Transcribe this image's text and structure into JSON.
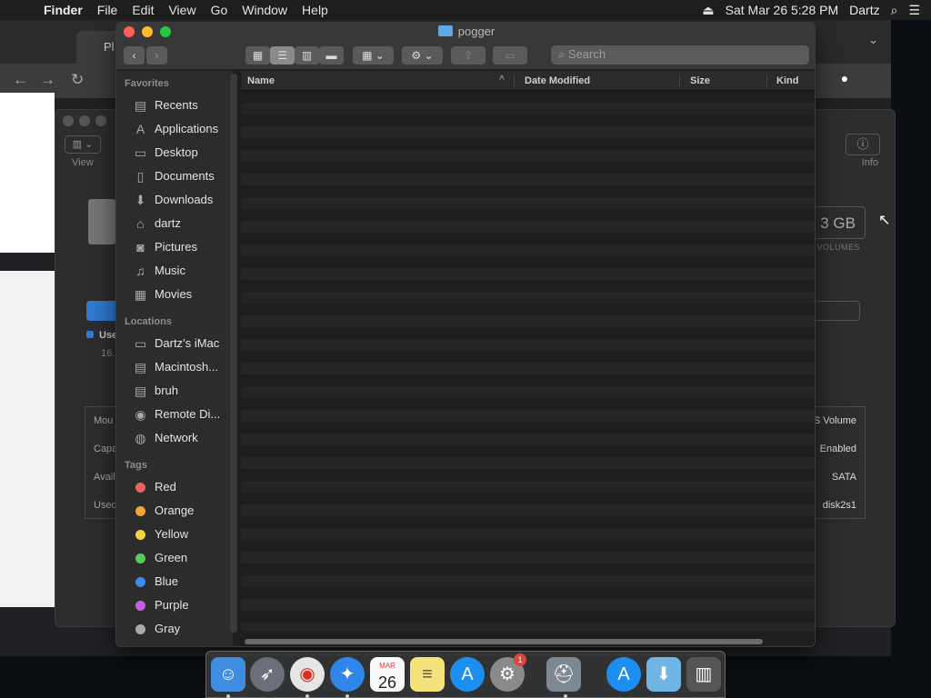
{
  "menubar": {
    "app": "Finder",
    "items": [
      "File",
      "Edit",
      "View",
      "Go",
      "Window",
      "Help"
    ],
    "clock": "Sat Mar 26  5:28 PM",
    "user": "Dartz"
  },
  "browser": {
    "tab_label": "Pl"
  },
  "disk_utility": {
    "view_label": "View",
    "info_label": "Info",
    "capacity": "3 GB",
    "volumes_label": "VOLUMES",
    "used_label": "Use",
    "used_value": "16.",
    "rows": [
      {
        "key": "Mou",
        "value": "S Volume"
      },
      {
        "key": "Capa",
        "value": "Enabled"
      },
      {
        "key": "Avail",
        "value": "SATA"
      },
      {
        "key": "Used",
        "value": "disk2s1"
      }
    ]
  },
  "finder": {
    "title": "pogger",
    "search_placeholder": "Search",
    "sidebar": {
      "favorites_header": "Favorites",
      "favorites": [
        {
          "label": "Recents",
          "icon": "recents-icon",
          "glyph": "▤"
        },
        {
          "label": "Applications",
          "icon": "applications-icon",
          "glyph": "A"
        },
        {
          "label": "Desktop",
          "icon": "desktop-icon",
          "glyph": "▭"
        },
        {
          "label": "Documents",
          "icon": "documents-icon",
          "glyph": "▯"
        },
        {
          "label": "Downloads",
          "icon": "downloads-icon",
          "glyph": "⬇"
        },
        {
          "label": "dartz",
          "icon": "home-icon",
          "glyph": "⌂"
        },
        {
          "label": "Pictures",
          "icon": "pictures-icon",
          "glyph": "◙"
        },
        {
          "label": "Music",
          "icon": "music-icon",
          "glyph": "♫"
        },
        {
          "label": "Movies",
          "icon": "movies-icon",
          "glyph": "▦"
        }
      ],
      "locations_header": "Locations",
      "locations": [
        {
          "label": "Dartz’s iMac",
          "icon": "imac-icon",
          "glyph": "▭"
        },
        {
          "label": "Macintosh...",
          "icon": "hard-disk-icon",
          "glyph": "▤"
        },
        {
          "label": "bruh",
          "icon": "disk-icon",
          "glyph": "▤"
        },
        {
          "label": "Remote Di...",
          "icon": "remote-disc-icon",
          "glyph": "◉"
        },
        {
          "label": "Network",
          "icon": "network-icon",
          "glyph": "◍"
        }
      ],
      "tags_header": "Tags",
      "tags": [
        {
          "label": "Red",
          "color": "#f05f5f"
        },
        {
          "label": "Orange",
          "color": "#f6a33a"
        },
        {
          "label": "Yellow",
          "color": "#f5d33f"
        },
        {
          "label": "Green",
          "color": "#52d05a"
        },
        {
          "label": "Blue",
          "color": "#3e8bf0"
        },
        {
          "label": "Purple",
          "color": "#c65ce0"
        },
        {
          "label": "Gray",
          "color": "#a9a9a9"
        }
      ]
    },
    "columns": [
      "Name",
      "Date Modified",
      "Size",
      "Kind"
    ]
  },
  "dock": {
    "calendar_month": "MAR",
    "calendar_day": "26",
    "badge_count": "1"
  }
}
